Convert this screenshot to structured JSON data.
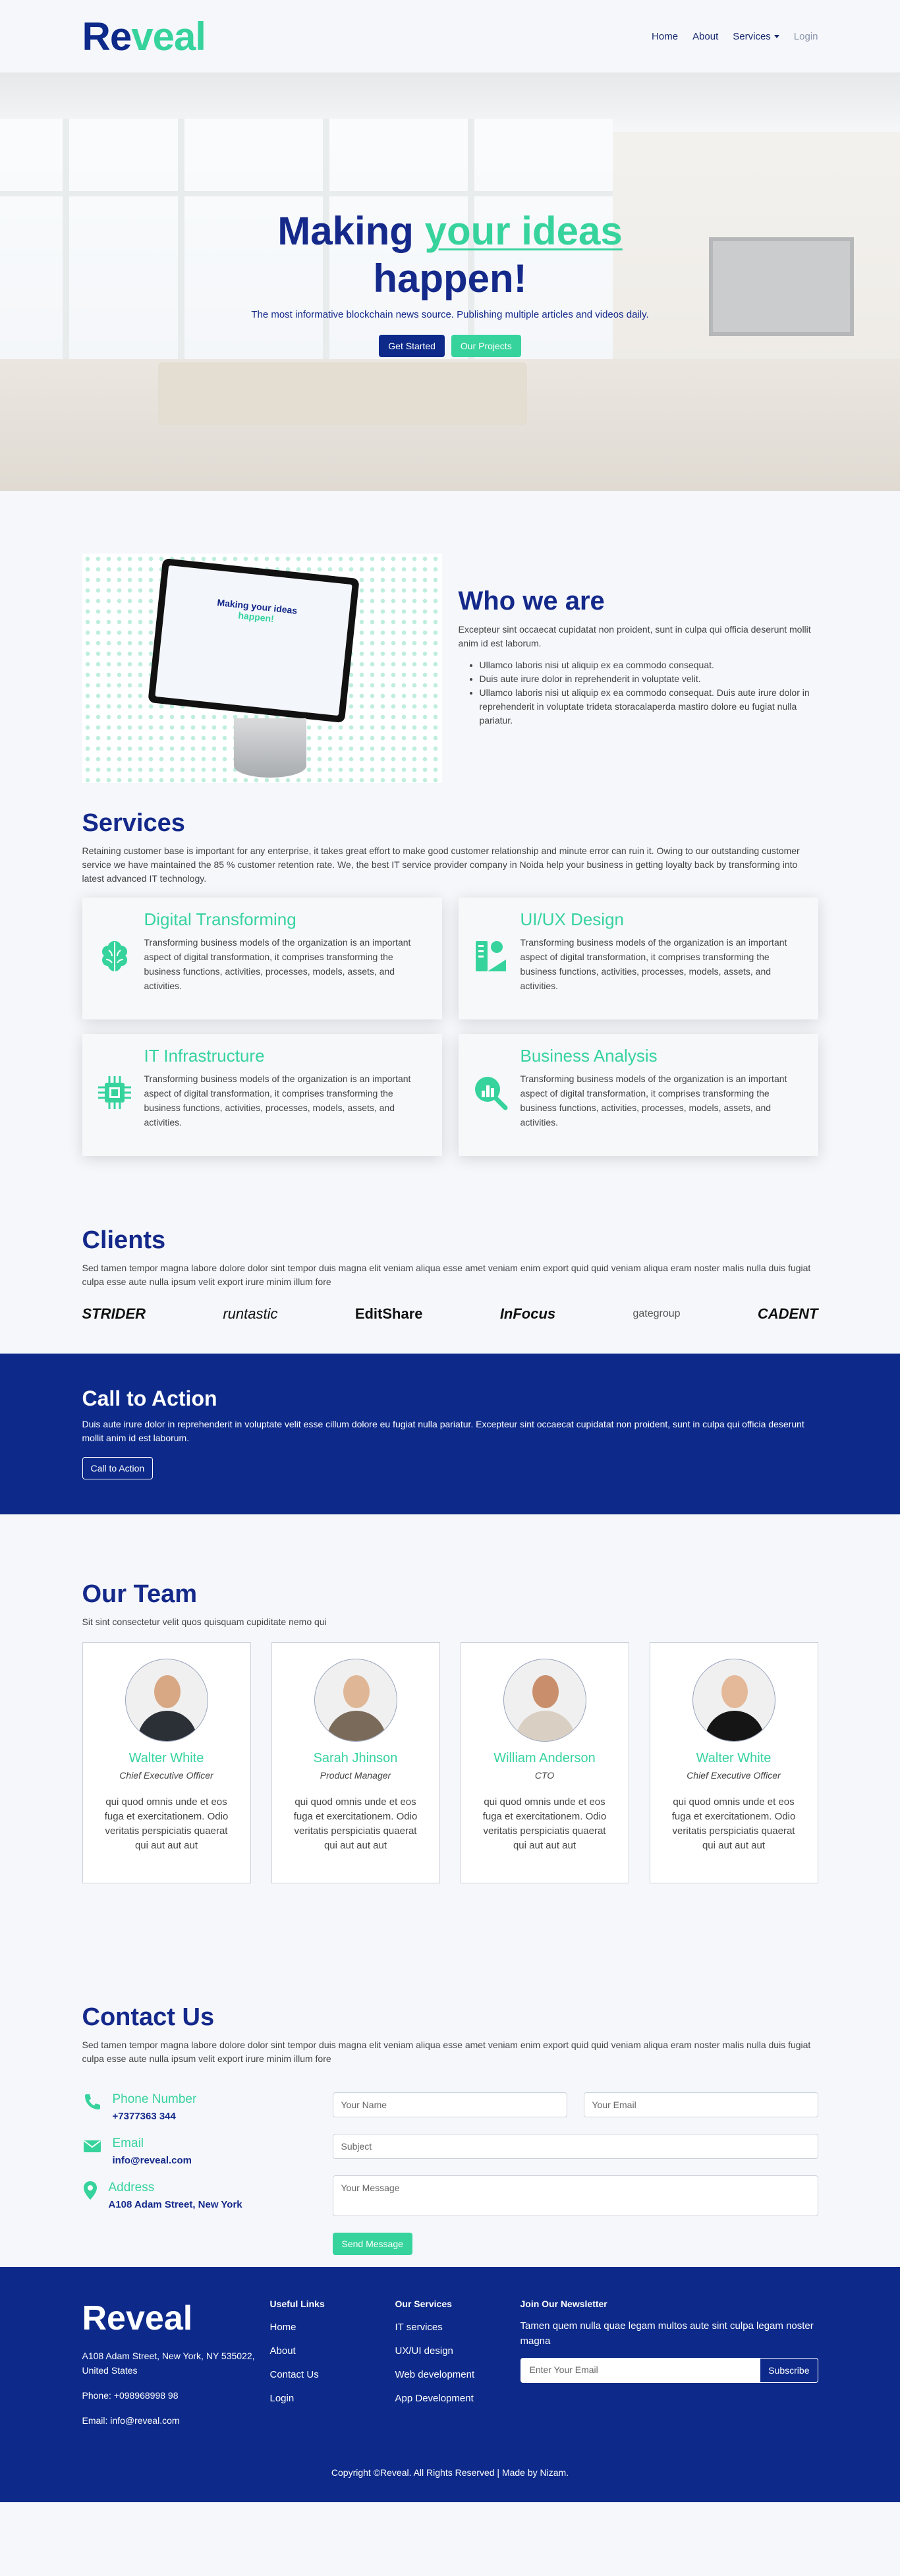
{
  "brand": {
    "re": "Re",
    "veal": "veal"
  },
  "nav": {
    "home": "Home",
    "about": "About",
    "services": "Services",
    "login": "Login"
  },
  "hero": {
    "title_start": "Making ",
    "title_accent": "your ideas",
    "title_end": "happen!",
    "subtitle": "The most informative blockchain news source. Publishing multiple articles and videos daily.",
    "btn_start": "Get Started",
    "btn_projects": "Our Projects"
  },
  "about": {
    "title": "Who we are",
    "text": "Excepteur sint occaecat cupidatat non proident, sunt in culpa qui officia deserunt mollit anim id est laborum.",
    "items": [
      "Ullamco laboris nisi ut aliquip ex ea commodo consequat.",
      "Duis aute irure dolor in reprehenderit in voluptate velit.",
      "Ullamco laboris nisi ut aliquip ex ea commodo consequat. Duis aute irure dolor in reprehenderit in voluptate trideta storacalaperda mastiro dolore eu fugiat nulla pariatur."
    ],
    "screen_line1": "Making your ideas",
    "screen_line2": "happen!"
  },
  "services": {
    "title": "Services",
    "text": "Retaining customer base is important for any enterprise, it takes great effort to make good customer relationship and minute error can ruin it. Owing to our outstanding customer service we have maintained the 85 % customer retention rate. We, the best IT service provider company in Noida help your business in getting loyalty back by transforming into latest advanced IT technology.",
    "cards": [
      {
        "title": "Digital Transforming",
        "icon": "brain-icon",
        "text": "Transforming business models of the organization is an important aspect of digital transformation, it comprises transforming the business functions, activities, processes, models, assets, and activities."
      },
      {
        "title": "UI/UX Design",
        "icon": "design-icon",
        "text": "Transforming business models of the organization is an important aspect of digital transformation, it comprises transforming the business functions, activities, processes, models, assets, and activities."
      },
      {
        "title": "IT Infrastructure",
        "icon": "cpu-icon",
        "text": "Transforming business models of the organization is an important aspect of digital transformation, it comprises transforming the business functions, activities, processes, models, assets, and activities."
      },
      {
        "title": "Business Analysis",
        "icon": "analytics-icon",
        "text": "Transforming business models of the organization is an important aspect of digital transformation, it comprises transforming the business functions, activities, processes, models, assets, and activities."
      }
    ]
  },
  "clients": {
    "title": "Clients",
    "text": "Sed tamen tempor magna labore dolore dolor sint tempor duis magna elit veniam aliqua esse amet veniam enim export quid quid veniam aliqua eram noster malis nulla duis fugiat culpa esse aute nulla ipsum velit export irure minim illum fore",
    "logos": [
      "STRIDER",
      "runtastic",
      "EditShare",
      "InFocus",
      "gategroup",
      "CADENT"
    ]
  },
  "cta": {
    "title": "Call to Action",
    "text": "Duis aute irure dolor in reprehenderit in voluptate velit esse cillum dolore eu fugiat nulla pariatur. Excepteur sint occaecat cupidatat non proident, sunt in culpa qui officia deserunt mollit anim id est laborum.",
    "button": "Call to Action"
  },
  "team": {
    "title": "Our Team",
    "subtitle": "Sit sint consectetur velit quos quisquam cupiditate nemo qui",
    "members": [
      {
        "name": "Walter White",
        "role": "Chief Executive Officer",
        "text": "qui quod omnis unde et eos fuga et exercitationem. Odio veritatis perspiciatis quaerat qui aut aut aut"
      },
      {
        "name": "Sarah Jhinson",
        "role": "Product Manager",
        "text": "qui quod omnis unde et eos fuga et exercitationem. Odio veritatis perspiciatis quaerat qui aut aut aut"
      },
      {
        "name": "William Anderson",
        "role": "CTO",
        "text": "qui quod omnis unde et eos fuga et exercitationem. Odio veritatis perspiciatis quaerat qui aut aut aut"
      },
      {
        "name": "Walter White",
        "role": "Chief Executive Officer",
        "text": "qui quod omnis unde et eos fuga et exercitationem. Odio veritatis perspiciatis quaerat qui aut aut aut"
      }
    ]
  },
  "contact": {
    "title": "Contact Us",
    "text": "Sed tamen tempor magna labore dolore dolor sint tempor duis magna elit veniam aliqua esse amet veniam enim export quid quid veniam aliqua eram noster malis nulla duis fugiat culpa esse aute nulla ipsum velit export irure minim illum fore",
    "phone_label": "Phone Number",
    "phone": "+7377363 344",
    "email_label": "Email",
    "email": "info@reveal.com",
    "address_label": "Address",
    "address": "A108 Adam Street, New York",
    "ph_name": "Your Name",
    "ph_email": "Your Email",
    "ph_subject": "Subject",
    "ph_message": "Your Message",
    "send": "Send Message"
  },
  "footer": {
    "brand": "Reveal",
    "address": "A108 Adam Street, New York, NY 535022, United States",
    "phone": "Phone: +098968998 98",
    "email": "Email: info@reveal.com",
    "useful_title": "Useful Links",
    "useful": [
      "Home",
      "About",
      "Contact Us",
      "Login"
    ],
    "services_title": "Our Services",
    "services": [
      "IT services",
      "UX/UI design",
      "Web development",
      "App Development"
    ],
    "newsletter_title": "Join Our Newsletter",
    "newsletter_text": "Tamen quem nulla quae legam multos aute sint culpa legam noster magna",
    "newsletter_placeholder": "Enter Your Email",
    "subscribe": "Subscribe",
    "copyright": "Copyright ©Reveal. All Rights Reserved | Made by Nizam."
  },
  "colors": {
    "primary": "#0d2a8a",
    "accent": "#37d39d",
    "background": "#f5f7fb"
  }
}
